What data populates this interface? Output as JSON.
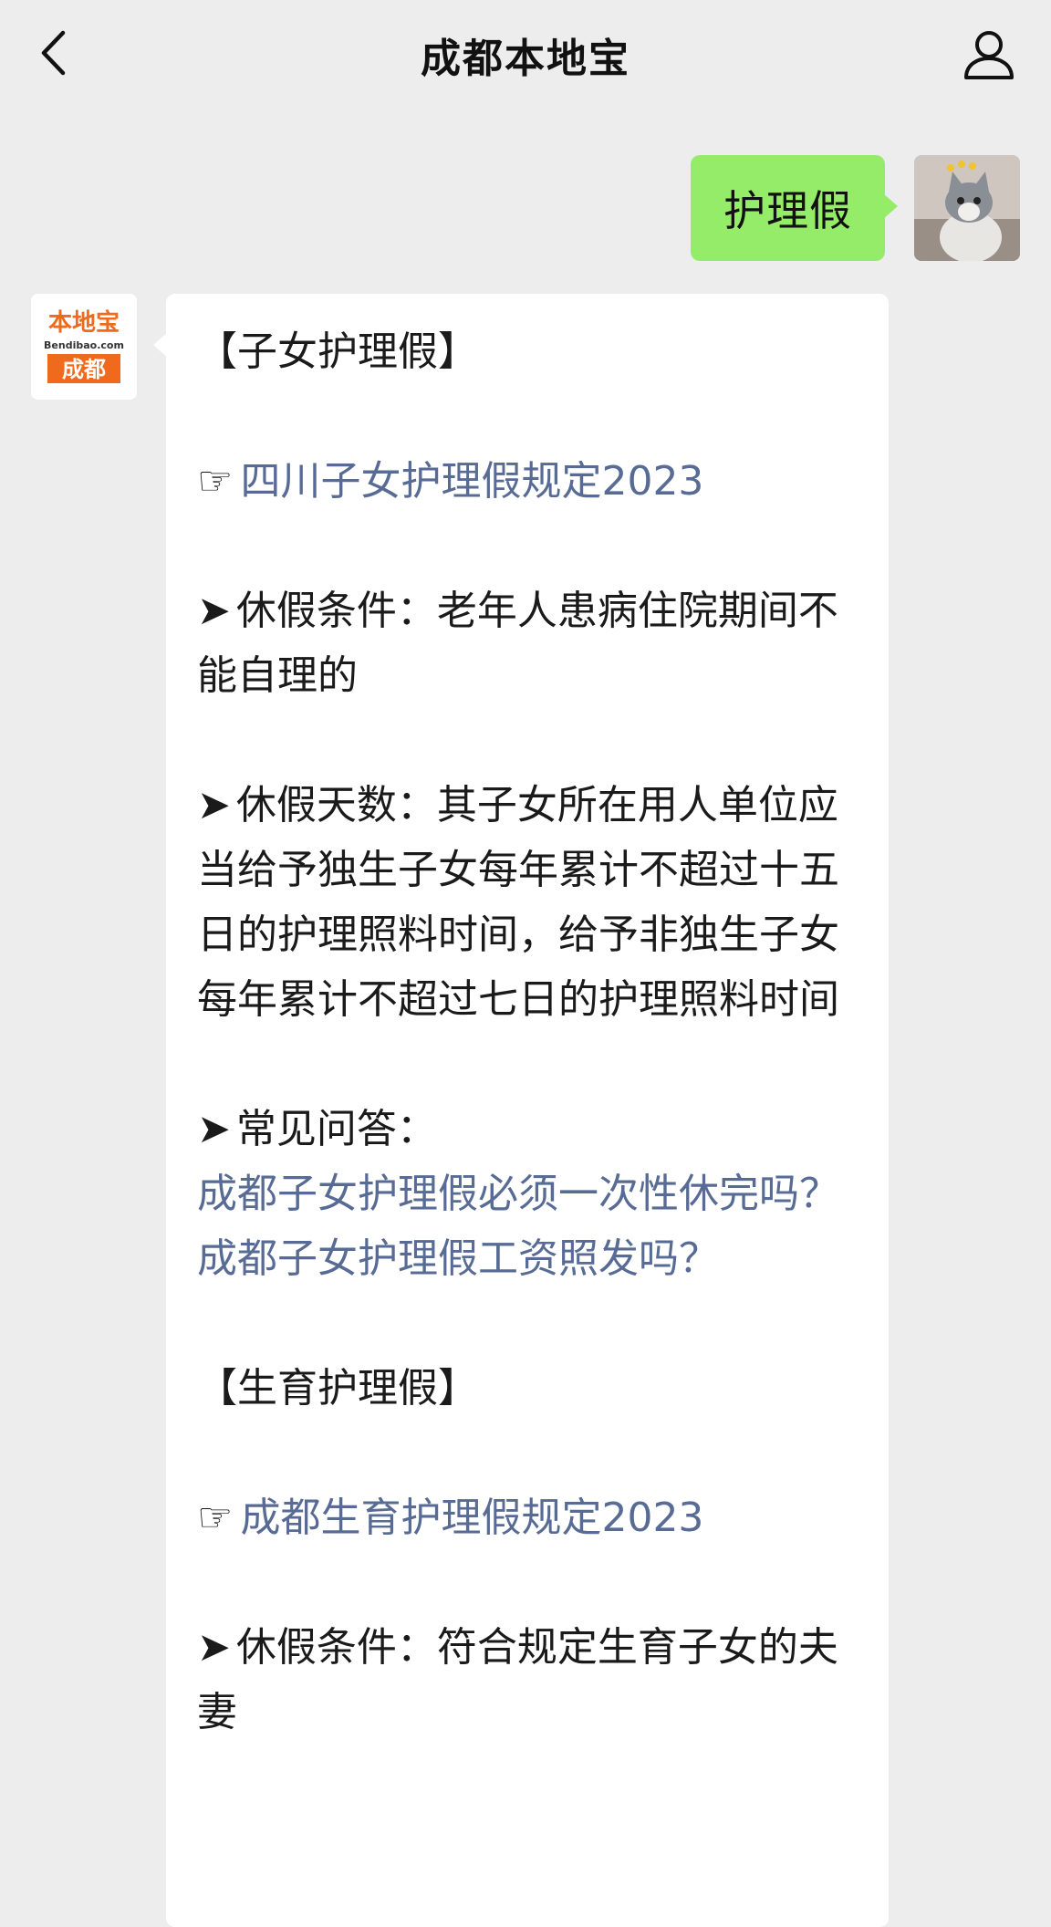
{
  "nav": {
    "title": "成都本地宝"
  },
  "outgoing": {
    "text": "护理假"
  },
  "incoming": {
    "avatar": {
      "brand_top": "本地宝",
      "brand_domain": "Bendibao.com",
      "brand_city": "成都"
    },
    "section1": {
      "heading": "【子女护理假】",
      "hand": "☞",
      "link": "四川子女护理假规定2023",
      "bullet": "➤",
      "conditions": "休假条件：老年人患病住院期间不能自理的",
      "days": "休假天数：其子女所在用人单位应当给予独生子女每年累计不超过十五日的护理照料时间，给予非独生子女每年累计不超过七日的护理照料时间",
      "faq_label": "常见问答：",
      "faq": [
        "成都子女护理假必须一次性休完吗？",
        "成都子女护理假工资照发吗？"
      ]
    },
    "section2": {
      "heading": "【生育护理假】",
      "hand": "☞",
      "link": "成都生育护理假规定2023",
      "bullet": "➤",
      "conditions": "休假条件：符合规定生育子女的夫妻"
    }
  },
  "colors": {
    "background": "#ededed",
    "outgoing_bubble": "#95ec69",
    "incoming_bubble": "#ffffff",
    "link": "#576b95",
    "brand_orange": "#f06a1d"
  }
}
